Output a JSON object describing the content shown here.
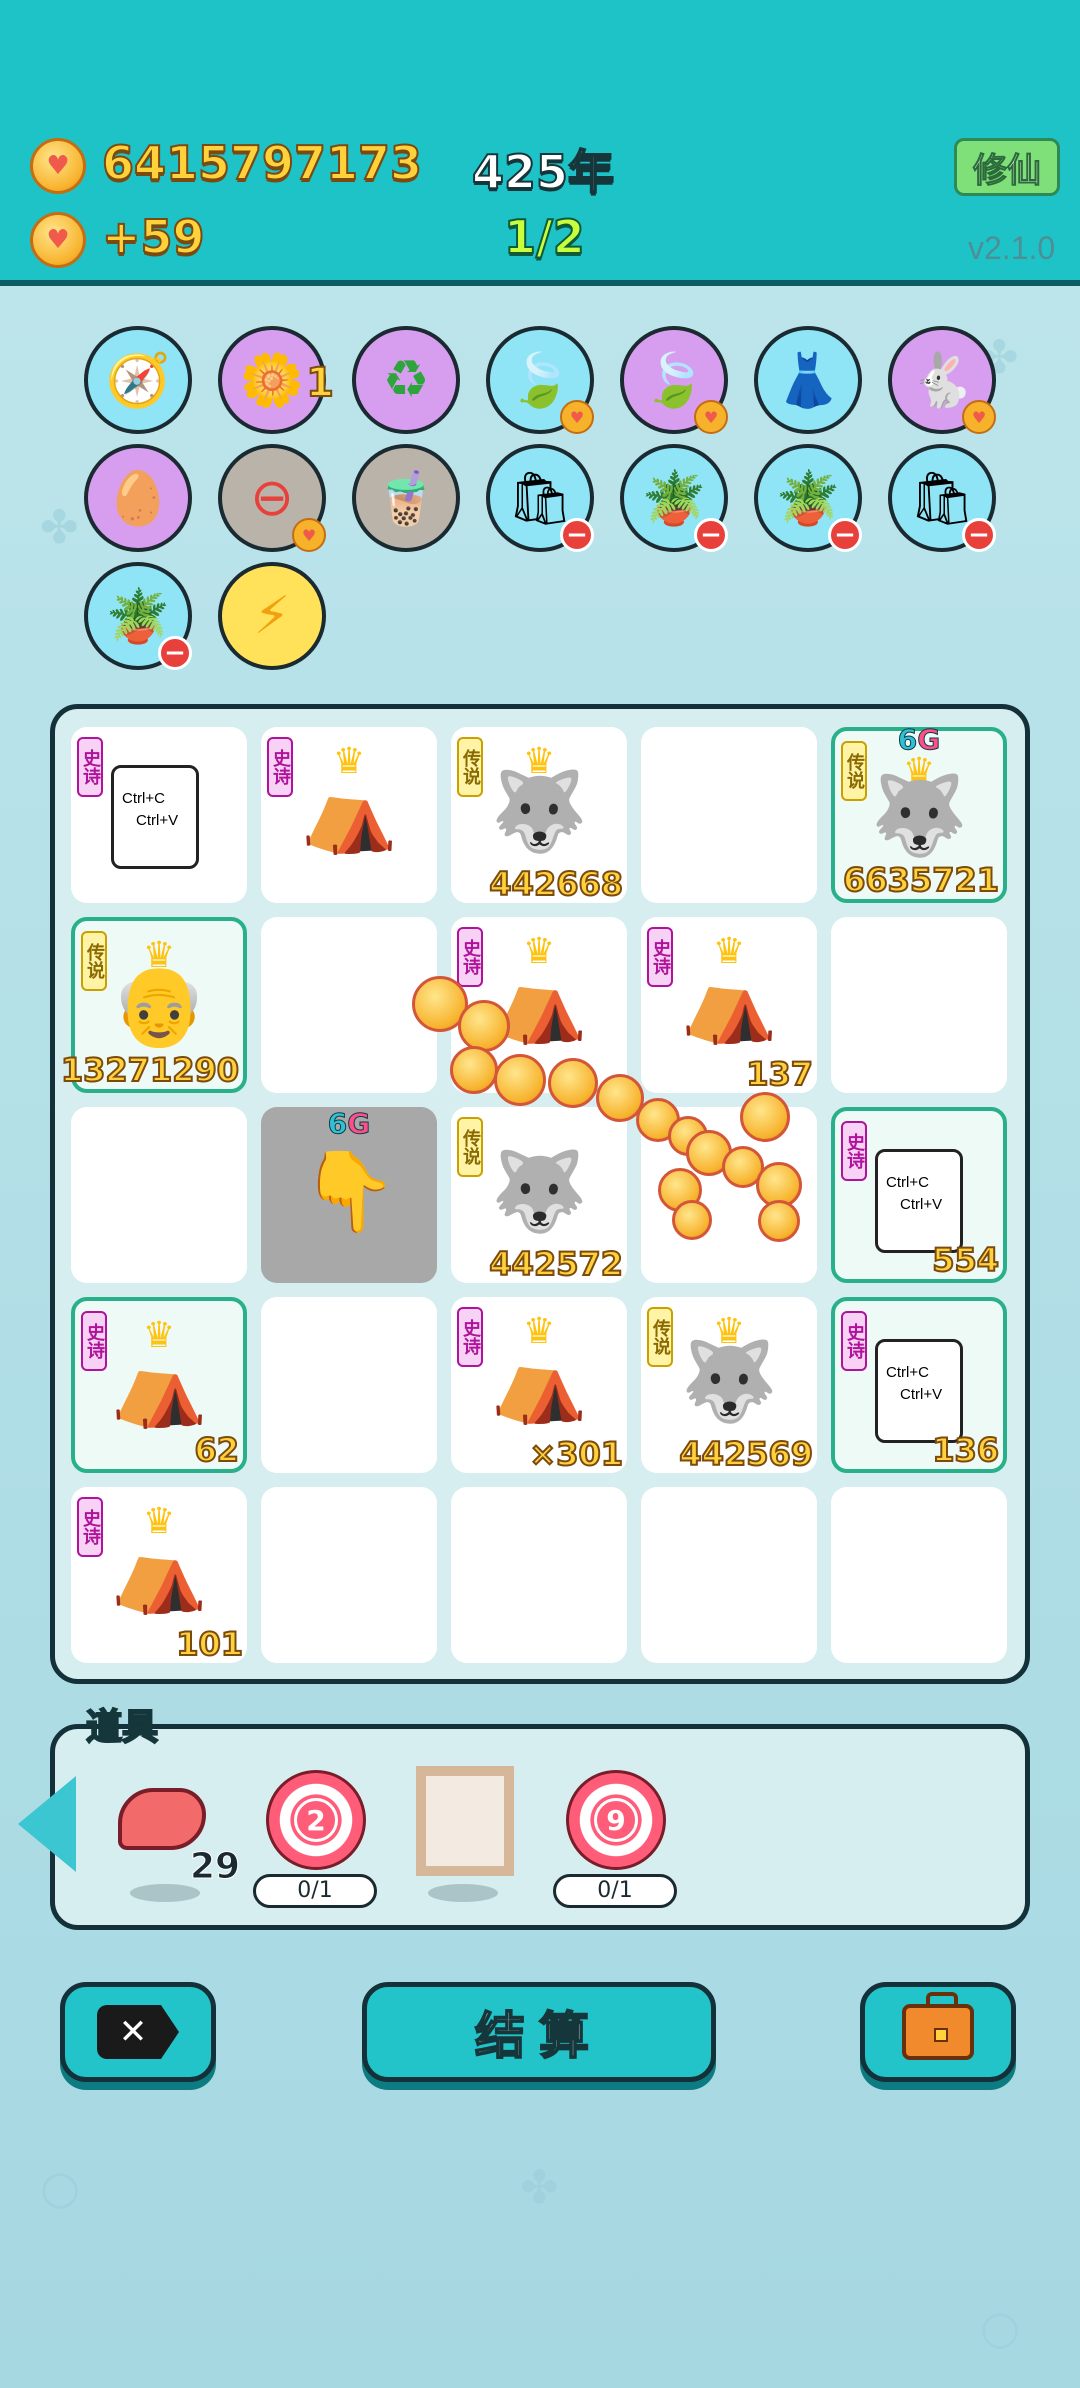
{
  "header": {
    "gold_total": "6415797173",
    "gold_rate": "+59",
    "year": "425年",
    "progress": "1/2",
    "xiuxian_label": "修仙",
    "version": "v2.1.0"
  },
  "inventory": {
    "row1": [
      "compass-icon",
      "flower-coin-icon",
      "recycle-icon",
      "leaf-icon",
      "leaf-icon",
      "skirt-icon",
      "rabbit-icon"
    ],
    "row1_badge": "1",
    "row2": [
      "egg-icon",
      "no-entry-icon",
      "bubble-tea-icon",
      "bag-icon",
      "potted-flower-icon",
      "potted-flower-icon",
      "bag-icon"
    ],
    "row3": [
      "potted-flower-icon",
      "lightning-icon"
    ]
  },
  "board": {
    "tag_epic": "史诗",
    "tag_legend": "传说",
    "level_label_6": "6",
    "level_label_g": "G",
    "copy_line1": "Ctrl+C",
    "copy_line2": "Ctrl+V",
    "counts": {
      "r1c3": "442668",
      "r1c5": "6635721",
      "r2c1": "13271290",
      "r2c4": "137",
      "r3c3": "442572",
      "r3c5": "554",
      "r4c1": "62",
      "r4c3": "×301",
      "r4c4": "442569",
      "r4c5": "136",
      "r5c1": "101"
    }
  },
  "items": {
    "label": "道具",
    "liver_count": "29",
    "target1_value": "2",
    "target1_progress": "0/1",
    "target2_value": "9",
    "target2_progress": "0/1"
  },
  "buttons": {
    "close_label": "✕",
    "settle_label": "结算"
  },
  "colors": {
    "header": "#1ec3c8",
    "accent_gold": "#ffd23c",
    "epic": "#b0139b",
    "legend": "#c9a000"
  }
}
